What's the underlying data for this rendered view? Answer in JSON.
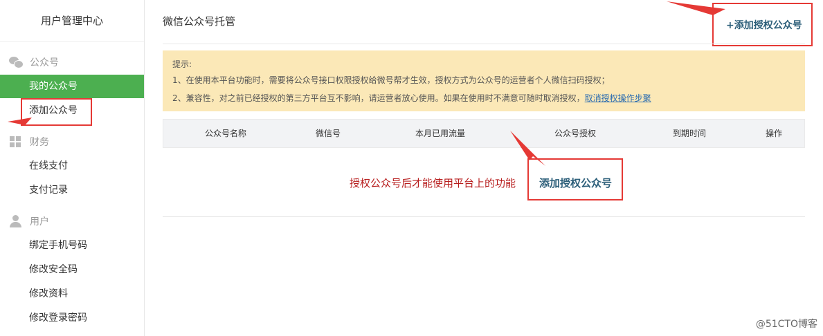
{
  "sidebar": {
    "title": "用户管理中心",
    "groups": [
      {
        "label": "公众号",
        "items": [
          {
            "label": "我的公众号"
          },
          {
            "label": "添加公众号"
          }
        ]
      },
      {
        "label": "财务",
        "items": [
          {
            "label": "在线支付"
          },
          {
            "label": "支付记录"
          }
        ]
      },
      {
        "label": "用户",
        "items": [
          {
            "label": "绑定手机号码"
          },
          {
            "label": "修改安全码"
          },
          {
            "label": "修改资料"
          },
          {
            "label": "修改登录密码"
          }
        ]
      }
    ]
  },
  "main": {
    "title": "微信公众号托管",
    "add_button": "+添加授权公众号",
    "notice": {
      "title": "提示:",
      "line1": "1、在使用本平台功能时，需要将公众号接口权限授权给微号帮才生效，授权方式为公众号的运营者个人微信扫码授权；",
      "line2": "2、兼容性，对之前已经授权的第三方平台互不影响，请运营者放心使用。如果在使用时不满意可随时取消授权，",
      "link": "取消授权操作步聚"
    },
    "table": {
      "columns": [
        "公众号名称",
        "微信号",
        "本月已用流量",
        "公众号授权",
        "到期时间",
        "操作"
      ]
    },
    "empty_message": "授权公众号后才能使用平台上的功能",
    "empty_link": "添加授权公众号"
  },
  "watermark": "@51CTO博客",
  "colors": {
    "active_green": "#4caf50",
    "highlight_red": "#e53935",
    "notice_bg": "#fbe8b7",
    "link_blue": "#2d5f7a"
  }
}
